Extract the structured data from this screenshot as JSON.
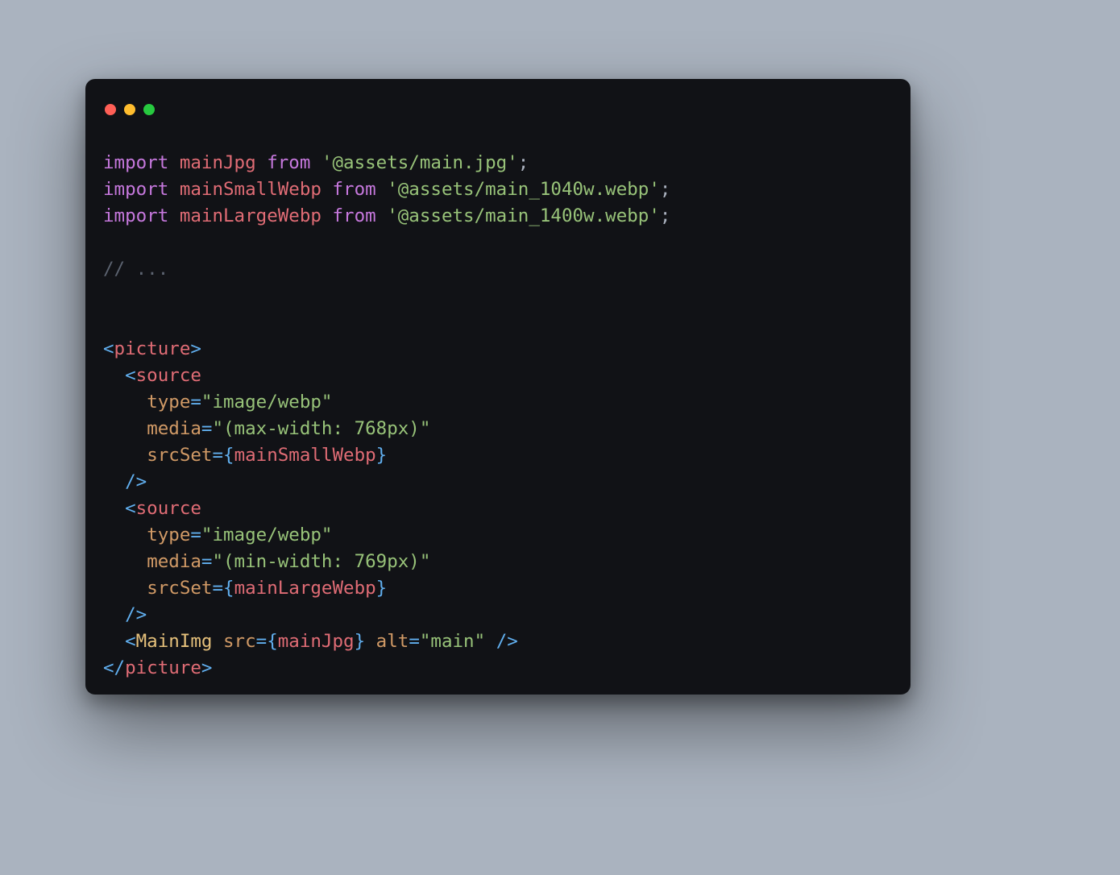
{
  "code": {
    "imports": [
      {
        "kw1": "import",
        "name": "mainJpg",
        "kw2": "from",
        "path": "'@assets/main.jpg'",
        "semi": ";"
      },
      {
        "kw1": "import",
        "name": "mainSmallWebp",
        "kw2": "from",
        "path": "'@assets/main_1040w.webp'",
        "semi": ";"
      },
      {
        "kw1": "import",
        "name": "mainLargeWebp",
        "kw2": "from",
        "path": "'@assets/main_1400w.webp'",
        "semi": ";"
      }
    ],
    "comment": "// ...",
    "jsx": {
      "open_picture_l": "<",
      "picture": "picture",
      "open_picture_r": ">",
      "source1": {
        "open_l": "<",
        "tag": "source",
        "attr_type": "type",
        "eq1": "=",
        "val_type": "\"image/webp\"",
        "attr_media": "media",
        "eq2": "=",
        "val_media": "\"(max-width: 768px)\"",
        "attr_srcset": "srcSet",
        "eq3": "=",
        "brace_l": "{",
        "expr": "mainSmallWebp",
        "brace_r": "}",
        "selfclose": "/>"
      },
      "source2": {
        "open_l": "<",
        "tag": "source",
        "attr_type": "type",
        "eq1": "=",
        "val_type": "\"image/webp\"",
        "attr_media": "media",
        "eq2": "=",
        "val_media": "\"(min-width: 769px)\"",
        "attr_srcset": "srcSet",
        "eq3": "=",
        "brace_l": "{",
        "expr": "mainLargeWebp",
        "brace_r": "}",
        "selfclose": "/>"
      },
      "mainimg": {
        "open_l": "<",
        "comp": "MainImg",
        "attr_src": "src",
        "eq1": "=",
        "brace_l": "{",
        "expr": "mainJpg",
        "brace_r": "}",
        "attr_alt": "alt",
        "eq2": "=",
        "val_alt": "\"main\"",
        "selfclose": "/>"
      },
      "close_picture_l": "</",
      "close_picture": "picture",
      "close_picture_r": ">"
    }
  }
}
